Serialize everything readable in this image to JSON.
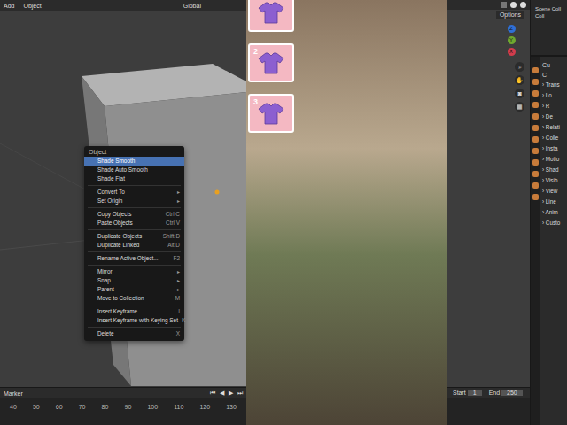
{
  "left_header": {
    "menus": [
      "Add",
      "Object"
    ],
    "transform": "Global"
  },
  "context_menu": {
    "title": "Object",
    "items": [
      {
        "label": "Shade Smooth",
        "shortcut": "",
        "arrow": "",
        "separator_before": false,
        "selected": true
      },
      {
        "label": "Shade Auto Smooth",
        "shortcut": "",
        "arrow": "",
        "separator_before": false,
        "selected": false
      },
      {
        "label": "Shade Flat",
        "shortcut": "",
        "arrow": "",
        "separator_before": false,
        "selected": false
      },
      {
        "label": "Convert To",
        "shortcut": "",
        "arrow": "▸",
        "separator_before": true,
        "selected": false
      },
      {
        "label": "Set Origin",
        "shortcut": "",
        "arrow": "▸",
        "separator_before": false,
        "selected": false
      },
      {
        "label": "Copy Objects",
        "shortcut": "Ctrl C",
        "arrow": "",
        "separator_before": true,
        "selected": false
      },
      {
        "label": "Paste Objects",
        "shortcut": "Ctrl V",
        "arrow": "",
        "separator_before": false,
        "selected": false
      },
      {
        "label": "Duplicate Objects",
        "shortcut": "Shift D",
        "arrow": "",
        "separator_before": true,
        "selected": false
      },
      {
        "label": "Duplicate Linked",
        "shortcut": "Alt D",
        "arrow": "",
        "separator_before": false,
        "selected": false
      },
      {
        "label": "Rename Active Object...",
        "shortcut": "F2",
        "arrow": "",
        "separator_before": true,
        "selected": false
      },
      {
        "label": "Mirror",
        "shortcut": "",
        "arrow": "▸",
        "separator_before": true,
        "selected": false
      },
      {
        "label": "Snap",
        "shortcut": "",
        "arrow": "▸",
        "separator_before": false,
        "selected": false
      },
      {
        "label": "Parent",
        "shortcut": "",
        "arrow": "▸",
        "separator_before": false,
        "selected": false
      },
      {
        "label": "Move to Collection",
        "shortcut": "M",
        "arrow": "",
        "separator_before": false,
        "selected": false
      },
      {
        "label": "Insert Keyframe",
        "shortcut": "I",
        "arrow": "",
        "separator_before": true,
        "selected": false
      },
      {
        "label": "Insert Keyframe with Keying Set",
        "shortcut": "K",
        "arrow": "",
        "separator_before": false,
        "selected": false
      },
      {
        "label": "Delete",
        "shortcut": "X",
        "arrow": "",
        "separator_before": true,
        "selected": false
      }
    ]
  },
  "overlay_buttons": [
    {
      "label": ""
    },
    {
      "label": "2"
    },
    {
      "label": "3"
    }
  ],
  "right_header": {
    "options": "Options"
  },
  "gizmo": [
    {
      "label": "Z",
      "color": "#2f6fd6"
    },
    {
      "label": "Y",
      "color": "#6fa82f"
    },
    {
      "label": "X",
      "color": "#d23c4c"
    }
  ],
  "outliner": [
    "Scene Coll",
    "Coll"
  ],
  "properties": {
    "header": [
      "Cu",
      "C"
    ],
    "sections": [
      "Trans",
      "Lo",
      "R",
      "De",
      "Relati",
      "Colle",
      "Insta",
      "Motio",
      "Shad",
      "Visib",
      "View",
      "Line",
      "Anim",
      "Custo"
    ]
  },
  "timeline": {
    "marker": "Marker",
    "controls": [
      "⏮",
      "◀",
      "▶",
      "⏭"
    ],
    "frames": [
      "40",
      "50",
      "60",
      "70",
      "80",
      "90",
      "100",
      "110",
      "120",
      "130"
    ],
    "start_label": "Start",
    "start": "1",
    "end_label": "End",
    "end": "250"
  }
}
